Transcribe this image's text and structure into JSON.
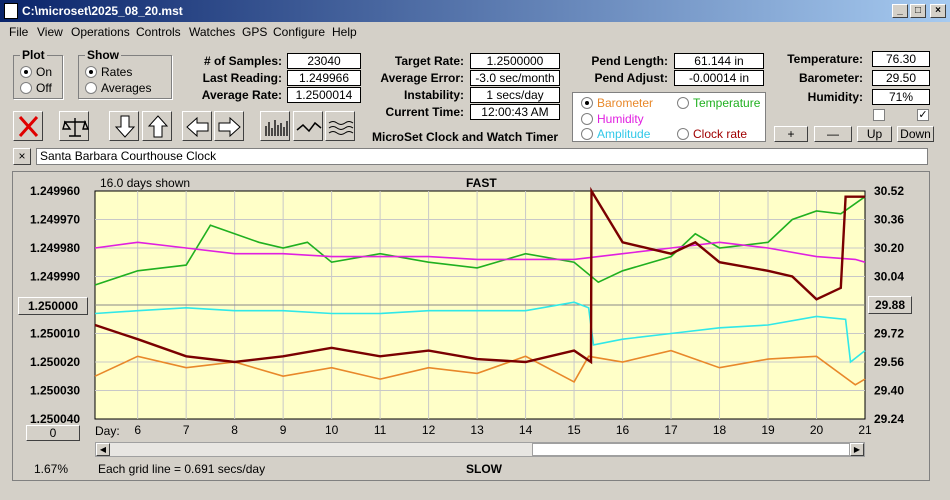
{
  "window": {
    "title": "C:\\microset\\2025_08_20.mst"
  },
  "menu": [
    "File",
    "View",
    "Operations",
    "Controls",
    "Watches",
    "GPS",
    "Configure",
    "Help"
  ],
  "plot": {
    "label": "Plot",
    "on": "On",
    "off": "Off"
  },
  "show": {
    "label": "Show",
    "rates": "Rates",
    "averages": "Averages"
  },
  "stats": {
    "samples_label": "# of Samples:",
    "samples": "23040",
    "last_label": "Last Reading:",
    "last": "1.249966",
    "avg_label": "Average Rate:",
    "avg": "1.2500014",
    "target_label": "Target Rate:",
    "target": "1.2500000",
    "err_label": "Average Error:",
    "err": "-3.0 sec/month",
    "inst_label": "Instability:",
    "inst": "1 secs/day",
    "time_label": "Current Time:",
    "time": "12:00:43 AM",
    "title": "MicroSet Clock and Watch Timer"
  },
  "pend": {
    "length_label": "Pend Length:",
    "length": "61.144 in",
    "adjust_label": "Pend Adjust:",
    "adjust": "-0.00014 in"
  },
  "env": {
    "temp_label": "Temperature:",
    "temp": "76.30",
    "baro_label": "Barometer:",
    "baro": "29.50",
    "hum_label": "Humidity:",
    "hum": "71%"
  },
  "series_select": {
    "barometer": "Barometer",
    "temperature": "Temperature",
    "humidity": "Humidity",
    "amplitude": "Amplitude",
    "clock_rate": "Clock rate"
  },
  "scale_buttons": {
    "plus": "+",
    "minus": "—",
    "up": "Up",
    "down": "Down"
  },
  "note": {
    "close": "×",
    "text": "Santa Barbara Courthouse Clock"
  },
  "chart_labels": {
    "days_shown": "16.0 days shown",
    "fast": "FAST",
    "slow": "SLOW",
    "day": "Day:",
    "grid_note": "Each grid line = 0.691 secs/day",
    "center_btn": "1.250000",
    "zero_btn": "0",
    "right_btn": "29.88",
    "pct": "1.67%"
  },
  "colors": {
    "barometer": "#e8882a",
    "temperature": "#20b020",
    "humidity": "#e020e0",
    "amplitude": "#30e8e8",
    "rate": "#7a0000",
    "chart_bg": "#ffffc8"
  },
  "chart_data": {
    "type": "line",
    "x_ticks": [
      6,
      7,
      8,
      9,
      10,
      11,
      12,
      13,
      14,
      15,
      16,
      17,
      18,
      19,
      20,
      21
    ],
    "xlim": [
      5.12,
      21
    ],
    "y_left_ticks": [
      "1.249960",
      "1.249970",
      "1.249980",
      "1.249990",
      "1.250000",
      "1.250010",
      "1.250020",
      "1.250030",
      "1.250040"
    ],
    "y_left_range": [
      1.24996,
      1.25004
    ],
    "y_right_ticks": [
      "30.52",
      "30.36",
      "30.20",
      "30.04",
      "29.88",
      "29.72",
      "29.56",
      "29.40",
      "29.24"
    ],
    "y_right_range": [
      29.24,
      30.52
    ],
    "series": [
      {
        "key": "temperature",
        "x": [
          5.12,
          6,
          7,
          7.5,
          8,
          8.5,
          9,
          9.5,
          10,
          11,
          12,
          13,
          14,
          15,
          15.5,
          16,
          17,
          17.5,
          18,
          19,
          19.5,
          20,
          20.5,
          21
        ],
        "y": [
          1.249993,
          1.249988,
          1.249986,
          1.249972,
          1.249975,
          1.249978,
          1.24998,
          1.249978,
          1.249985,
          1.249982,
          1.249985,
          1.249987,
          1.249982,
          1.249985,
          1.249992,
          1.249988,
          1.249983,
          1.249975,
          1.24998,
          1.249978,
          1.24997,
          1.249967,
          1.249968,
          1.249962
        ]
      },
      {
        "key": "humidity",
        "x": [
          5.12,
          6,
          7,
          8,
          9,
          10,
          11,
          12,
          13,
          14,
          15,
          16,
          17,
          18,
          19,
          20,
          20.8,
          21
        ],
        "y": [
          1.24998,
          1.249978,
          1.24998,
          1.249982,
          1.249982,
          1.249983,
          1.249983,
          1.249983,
          1.249984,
          1.249984,
          1.249984,
          1.249982,
          1.24998,
          1.249978,
          1.24998,
          1.249983,
          1.249984,
          1.249985
        ]
      },
      {
        "key": "amplitude",
        "x": [
          5.12,
          6,
          7,
          8,
          9,
          10,
          11,
          12,
          13,
          14,
          15,
          15.3,
          15.4,
          16,
          17,
          18,
          19,
          20,
          20.6,
          20.7,
          21
        ],
        "y": [
          1.250003,
          1.250002,
          1.250001,
          1.250002,
          1.250002,
          1.250003,
          1.250003,
          1.250002,
          1.250002,
          1.250002,
          1.249999,
          1.250001,
          1.250014,
          1.250012,
          1.25001,
          1.250008,
          1.250007,
          1.250004,
          1.250005,
          1.25002,
          1.250016
        ]
      },
      {
        "key": "barometer",
        "x": [
          5.12,
          6,
          7,
          8,
          9,
          10,
          11,
          12,
          13,
          14,
          15,
          15.3,
          16,
          17,
          18,
          19,
          20,
          20.8,
          21
        ],
        "y": [
          1.250025,
          1.250018,
          1.250022,
          1.25002,
          1.250025,
          1.250022,
          1.250026,
          1.250022,
          1.250024,
          1.250018,
          1.250027,
          1.250018,
          1.25002,
          1.250016,
          1.250022,
          1.250019,
          1.250018,
          1.250028,
          1.250026
        ]
      },
      {
        "key": "rate",
        "x": [
          5.12,
          6,
          7,
          8,
          9,
          10,
          11,
          12,
          13,
          14,
          15,
          15.35,
          15.36,
          16,
          17,
          17.5,
          18,
          19,
          19.5,
          20,
          20.5,
          20.6,
          21
        ],
        "y": [
          1.250007,
          1.250012,
          1.250018,
          1.25002,
          1.250018,
          1.250015,
          1.250018,
          1.250016,
          1.250019,
          1.25002,
          1.250016,
          1.25002,
          1.24996,
          1.249978,
          1.249982,
          1.249978,
          1.249985,
          1.249988,
          1.24999,
          1.249998,
          1.249994,
          1.249962,
          1.249962
        ]
      }
    ]
  }
}
